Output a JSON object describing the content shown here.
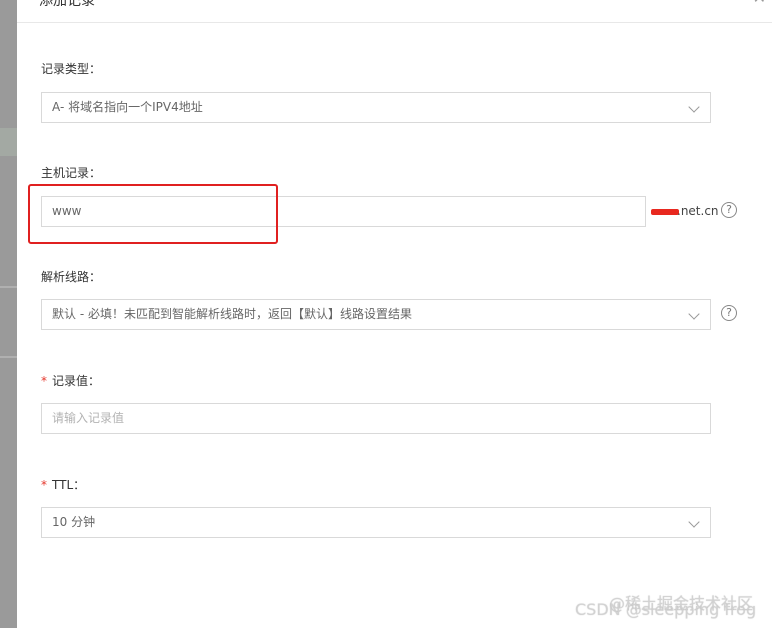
{
  "dialog": {
    "title": "添加记录",
    "close_icon": "close-icon"
  },
  "record_type": {
    "label": "记录类型：",
    "value": "A- 将域名指向一个IPV4地址"
  },
  "host_record": {
    "label": "主机记录：",
    "value": "www",
    "domain_suffix": ".net.cn"
  },
  "resolution_line": {
    "label": "解析线路：",
    "value": "默认 - 必填！未匹配到智能解析线路时，返回【默认】线路设置结果"
  },
  "record_value": {
    "required_mark": "*",
    "label": "记录值：",
    "placeholder": "请输入记录值"
  },
  "ttl": {
    "required_mark": "*",
    "label": "TTL：",
    "value": "10 分钟"
  },
  "watermarks": {
    "juejin": "@稀土掘金技术社区",
    "csdn": "CSDN @sleepping frog"
  },
  "colors": {
    "highlight": "#e02020",
    "required": "#e5372c",
    "border": "#d9d9d9"
  }
}
